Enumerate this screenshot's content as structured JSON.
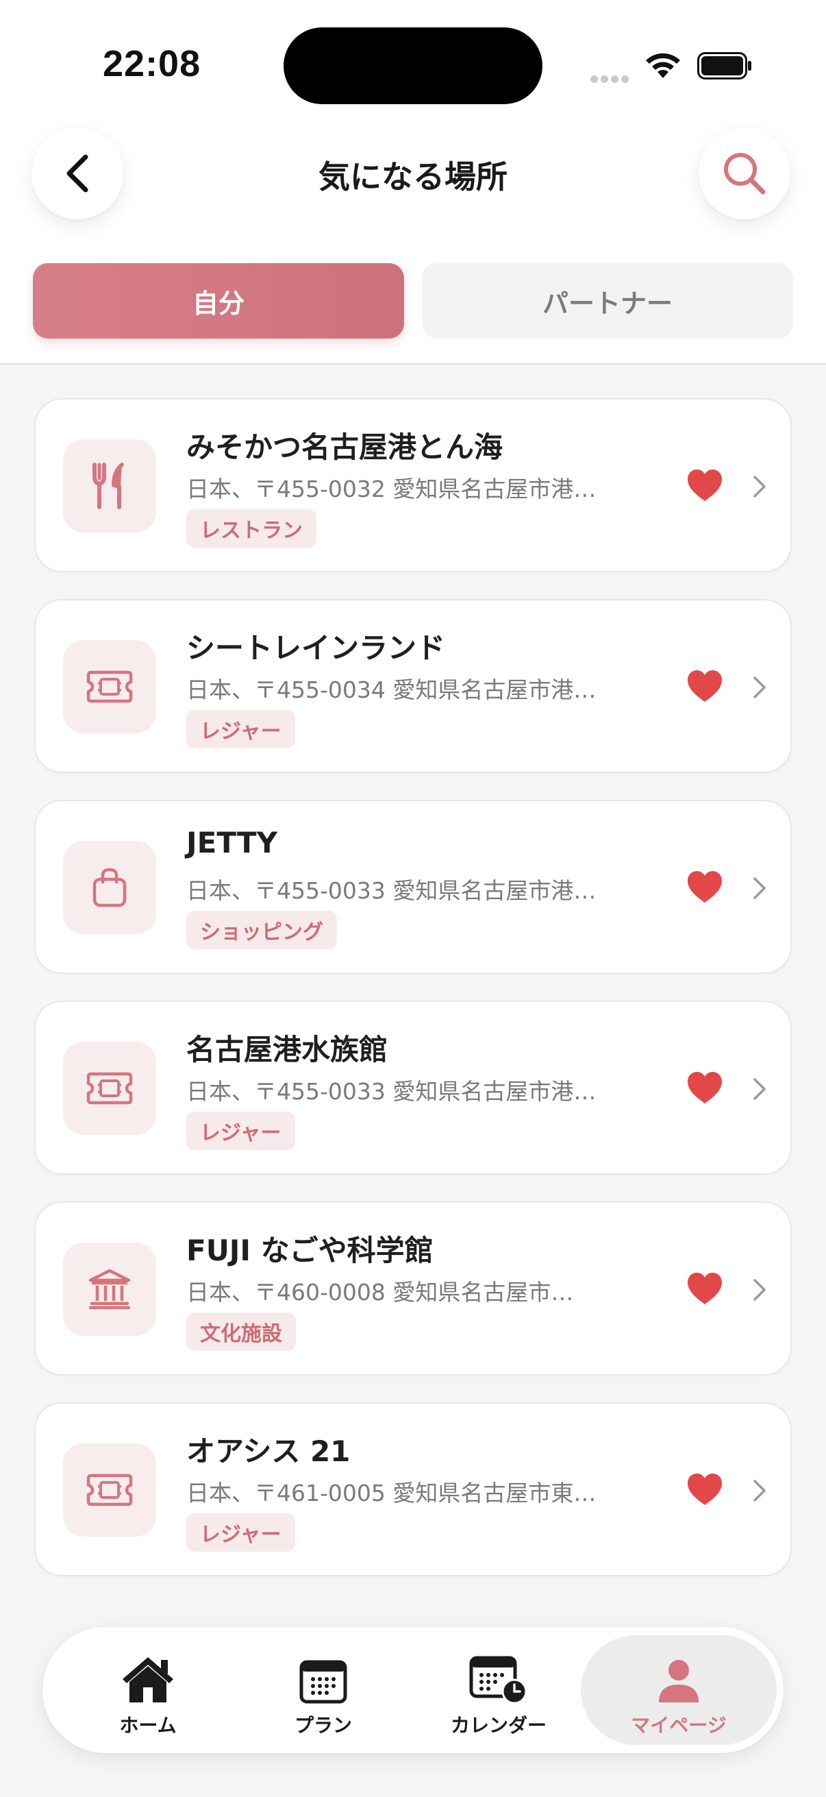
{
  "status_bar": {
    "time": "22:08"
  },
  "header": {
    "title": "気になる場所"
  },
  "segments": {
    "self_label": "自分",
    "partner_label": "パートナー",
    "selected": "self"
  },
  "colors": {
    "accent": "#d77f88",
    "heart": "#e24848",
    "tag_bg": "#f7eaea",
    "icon_bg": "#f7eded"
  },
  "places": [
    {
      "name": "みそかつ名古屋港とん海",
      "address": "日本、〒455-0032 愛知県名古屋市港…",
      "category": "レストラン",
      "icon": "utensils-icon",
      "favorite": true
    },
    {
      "name": "シートレインランド",
      "address": "日本、〒455-0034 愛知県名古屋市港…",
      "category": "レジャー",
      "icon": "ticket-icon",
      "favorite": true
    },
    {
      "name": "JETTY",
      "address": "日本、〒455-0033 愛知県名古屋市港…",
      "category": "ショッピング",
      "icon": "shopping-bag-icon",
      "favorite": true
    },
    {
      "name": "名古屋港水族館",
      "address": "日本、〒455-0033 愛知県名古屋市港…",
      "category": "レジャー",
      "icon": "ticket-icon",
      "favorite": true
    },
    {
      "name": "FUJI なごや科学館",
      "address": "日本、〒460-0008 愛知県名古屋市…",
      "category": "文化施設",
      "icon": "museum-icon",
      "favorite": true
    },
    {
      "name": "オアシス 21",
      "address": "日本、〒461-0005 愛知県名古屋市東…",
      "category": "レジャー",
      "icon": "ticket-icon",
      "favorite": true
    }
  ],
  "bottom_nav": {
    "items": [
      {
        "label": "ホーム",
        "icon": "home-icon"
      },
      {
        "label": "プラン",
        "icon": "calendar-icon"
      },
      {
        "label": "カレンダー",
        "icon": "calendar-clock-icon"
      },
      {
        "label": "マイページ",
        "icon": "person-icon"
      }
    ],
    "active": "マイページ"
  }
}
